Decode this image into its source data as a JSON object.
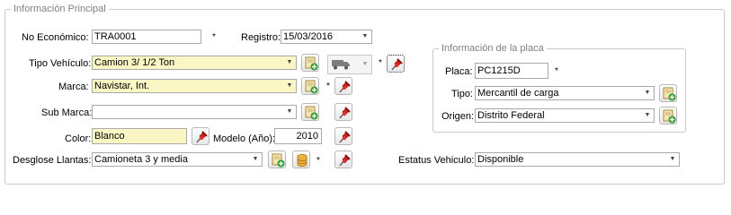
{
  "main_group": {
    "legend": "Información Principal",
    "no_economico": {
      "label": "No Económico:",
      "value": "TRA0001"
    },
    "registro": {
      "label": "Registro:",
      "value": "15/03/2016"
    },
    "tipo_vehiculo": {
      "label": "Tipo Vehículo:",
      "value": "Camion 3/ 1/2 Ton"
    },
    "marca": {
      "label": "Marca:",
      "value": "Navistar, Int."
    },
    "sub_marca": {
      "label": "Sub Marca:",
      "value": ""
    },
    "color": {
      "label": "Color:",
      "value": "Blanco"
    },
    "modelo": {
      "label": "Modelo (Año):",
      "value": "2010"
    },
    "desglose_llantas": {
      "label": "Desglose Llantas:",
      "value": "Camioneta 3 y media"
    },
    "estatus_vehiculo": {
      "label": "Estatus Vehiculo:",
      "value": "Disponible"
    },
    "required_mark": "*"
  },
  "plate_group": {
    "legend": "Información de la placa",
    "placa": {
      "label": "Placa:",
      "value": "PC1215D"
    },
    "tipo": {
      "label": "Tipo:",
      "value": "Mercantil de carga"
    },
    "origen": {
      "label": "Origen:",
      "value": "Distrito Federal"
    }
  },
  "icons": {
    "add": "add-document-icon",
    "pin": "pushpin-icon",
    "truck": "truck-icon",
    "database": "database-icon",
    "dropdown": "chevron-down-icon"
  },
  "colors": {
    "required_field_bg": "#fbf7c4",
    "group_border": "#c9c9c9",
    "legend_text": "#808080",
    "pin_red": "#d81f1f",
    "add_plus": "#2f9e2f"
  }
}
